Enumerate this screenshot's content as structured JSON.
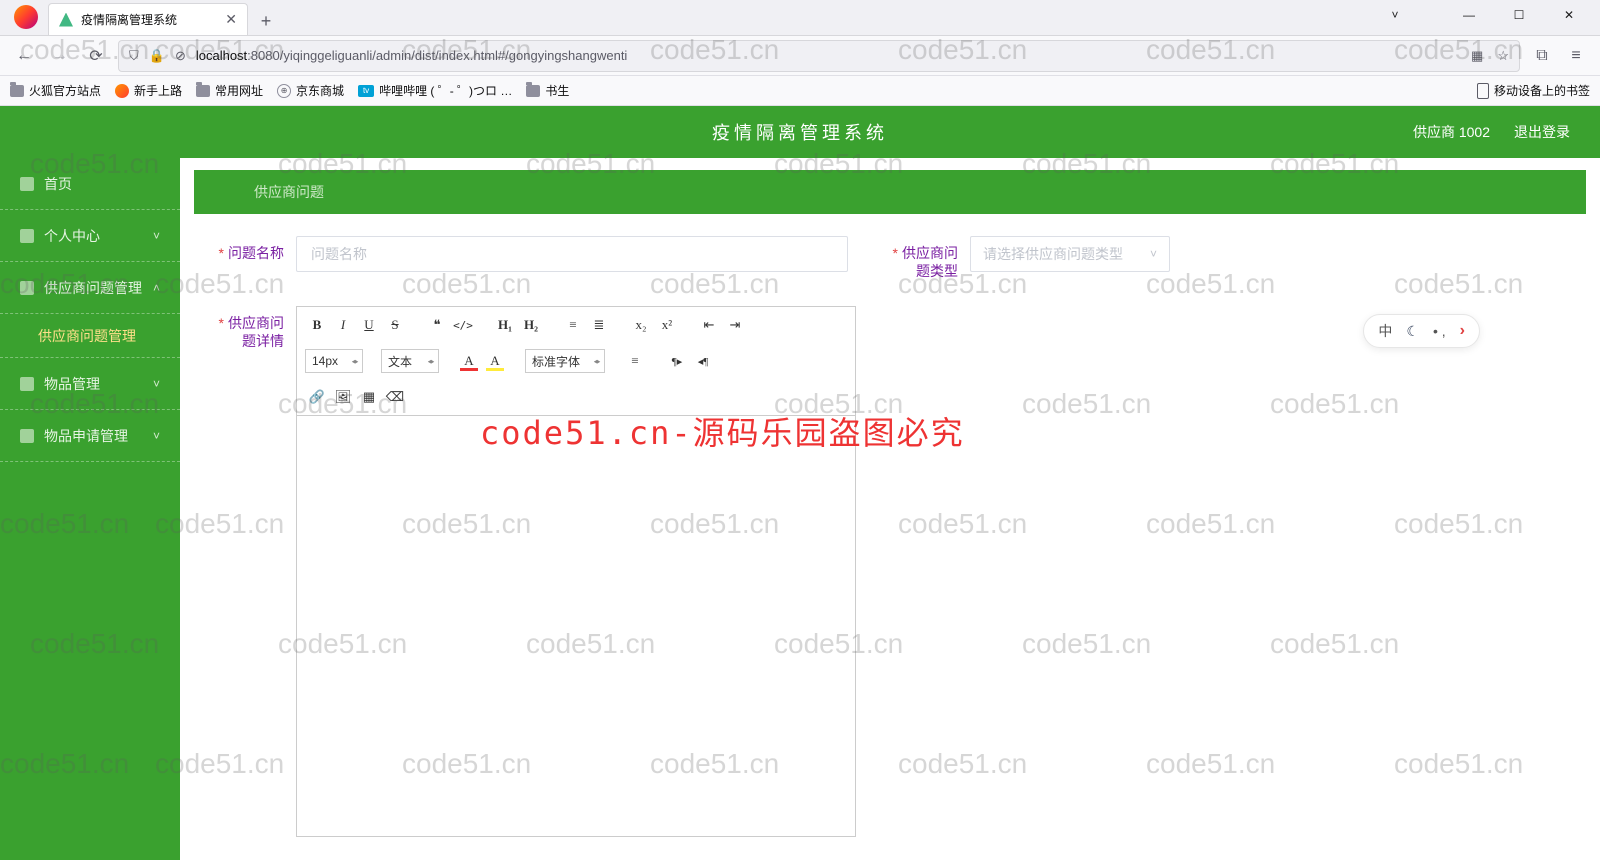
{
  "browser": {
    "tab_title": "疫情隔离管理系统",
    "url_host": "localhost",
    "url_port_path": ":8080/yiqinggeliguanli/admin/dist/index.html#/gongyingshangwenti",
    "url_lock_prefix": "⊘",
    "bookmarks": {
      "b0": "火狐官方站点",
      "b1": "新手上路",
      "b2": "常用网址",
      "b3": "京东商城",
      "b4": "哔哩哔哩 (  ゜- ゜)つロ …",
      "b5": "书生",
      "mobile": "移动设备上的书签"
    }
  },
  "app": {
    "title": "疫情隔离管理系统",
    "user_label": "供应商 1002",
    "logout": "退出登录"
  },
  "sidebar": {
    "home": "首页",
    "profile": "个人中心",
    "supplier_q_mgmt": "供应商问题管理",
    "supplier_q_mgmt_sub": "供应商问题管理",
    "goods_mgmt": "物品管理",
    "goods_apply_mgmt": "物品申请管理"
  },
  "crumb": {
    "current": "供应商问题"
  },
  "form": {
    "name_label": "问题名称",
    "name_placeholder": "问题名称",
    "type_label_l1": "供应商问",
    "type_label_l2": "题类型",
    "type_placeholder": "请选择供应商问题类型",
    "detail_label_l1": "供应商问",
    "detail_label_l2": "题详情"
  },
  "editor": {
    "font_size": "14px",
    "format": "文本",
    "font_family": "标准字体",
    "btn": {
      "bold": "B",
      "italic": "I",
      "underline": "U",
      "strike": "S",
      "quote": "❝",
      "code": "</>",
      "h1": "H₁",
      "h2": "H₂",
      "ol": "≡",
      "ul": "≣",
      "sub": "x₂",
      "sup": "x²",
      "outdent": "⇤",
      "indent": "⇥",
      "ltr": "¶▸",
      "rtl": "◂¶",
      "align": "≡",
      "link": "🔗",
      "image": "🖼",
      "video": "▦",
      "clear": "⌫"
    }
  },
  "ime": {
    "lang": "中",
    "dots": "• ,"
  },
  "watermark": "code51.cn",
  "big_watermark": "code51.cn-源码乐园盗图必究"
}
